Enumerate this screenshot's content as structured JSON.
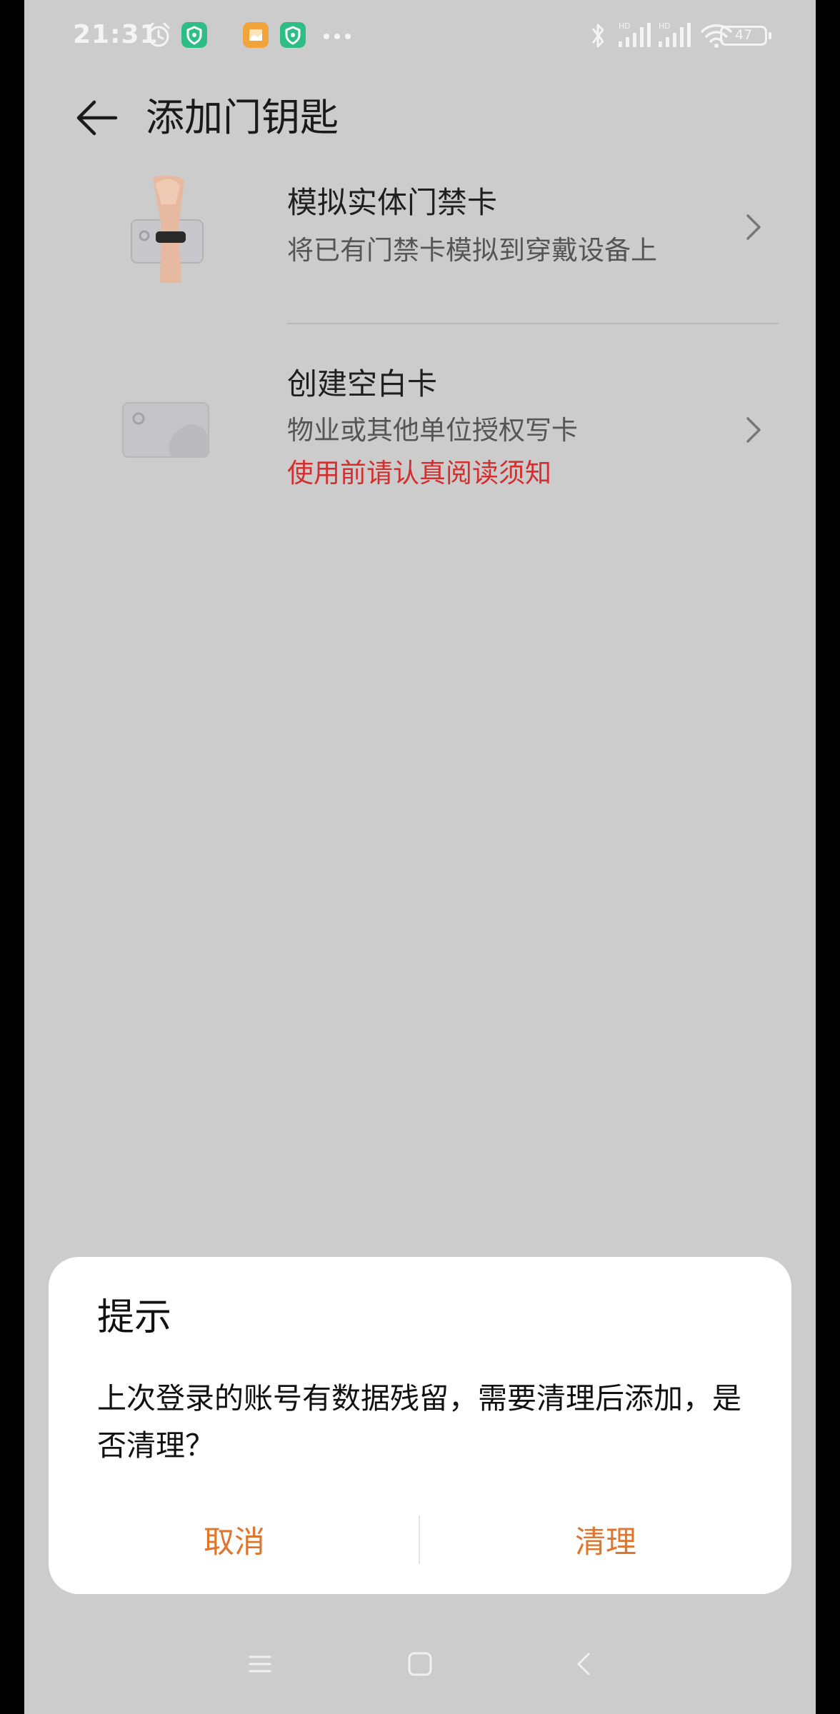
{
  "status_bar": {
    "time": "21:31",
    "battery": "47",
    "icons": [
      "alarm-icon",
      "shield-app-icon",
      "gallery-app-icon",
      "shield-app-icon",
      "more-dots-icon",
      "bluetooth-icon",
      "hd-signal-icon",
      "hd-signal-icon",
      "wifi-icon",
      "battery-icon"
    ],
    "colors": {
      "shield_app": "#2ebd85",
      "gallery_app": "#f2a33a"
    }
  },
  "header": {
    "title": "添加门钥匙"
  },
  "items": [
    {
      "title": "模拟实体门禁卡",
      "subtitle": "将已有门禁卡模拟到穿戴设备上",
      "icon": "wristband-card-icon"
    },
    {
      "title": "创建空白卡",
      "subtitle": "物业或其他单位授权写卡",
      "warning": "使用前请认真阅读须知",
      "icon": "blank-card-icon"
    }
  ],
  "dialog": {
    "title": "提示",
    "message": "上次登录的账号有数据残留，需要清理后添加，是否清理？",
    "cancel_label": "取消",
    "confirm_label": "清理",
    "accent_color": "#e0752e"
  },
  "nav_bar": {
    "icons": [
      "menu-icon",
      "home-icon",
      "back-icon"
    ]
  }
}
